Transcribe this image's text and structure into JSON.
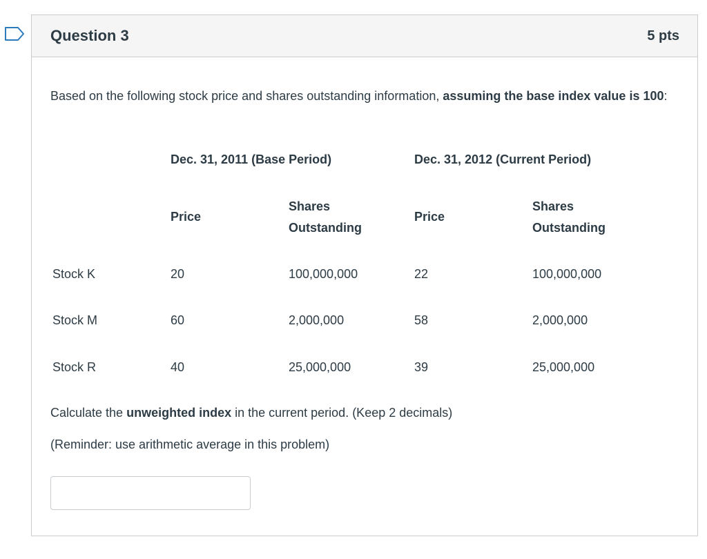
{
  "question": {
    "title": "Question 3",
    "points": "5 pts",
    "intro_plain": "Based on the following stock price and shares outstanding information, ",
    "intro_bold": "assuming the base index value is 100",
    "intro_end": ":"
  },
  "table": {
    "period_headers": [
      "Dec. 31, 2011 (Base Period)",
      "Dec. 31, 2012 (Current Period)"
    ],
    "column_headers": [
      {
        "line1": "Price",
        "line2": ""
      },
      {
        "line1": "Shares",
        "line2": "Outstanding"
      },
      {
        "line1": "Price",
        "line2": ""
      },
      {
        "line1": "Shares",
        "line2": "Outstanding"
      }
    ],
    "rows": [
      {
        "stock": "Stock K",
        "base_price": "20",
        "base_shares": "100,000,000",
        "cur_price": "22",
        "cur_shares": "100,000,000"
      },
      {
        "stock": "Stock M",
        "base_price": "60",
        "base_shares": "2,000,000",
        "cur_price": "58",
        "cur_shares": "2,000,000"
      },
      {
        "stock": "Stock R",
        "base_price": "40",
        "base_shares": "25,000,000",
        "cur_price": "39",
        "cur_shares": "25,000,000"
      }
    ]
  },
  "prompt": {
    "calc_pre": "Calculate the ",
    "calc_bold": "unweighted index",
    "calc_post": " in the current period. (Keep 2 decimals)",
    "reminder": "(Reminder: use arithmetic average in this problem)"
  },
  "answer": {
    "value": ""
  },
  "icons": {
    "bookmark": "bookmark-icon"
  },
  "colors": {
    "border": "#c7cdd1",
    "header_bg": "#f5f5f5",
    "text": "#2d3b45",
    "bookmark": "#2b7abc"
  }
}
